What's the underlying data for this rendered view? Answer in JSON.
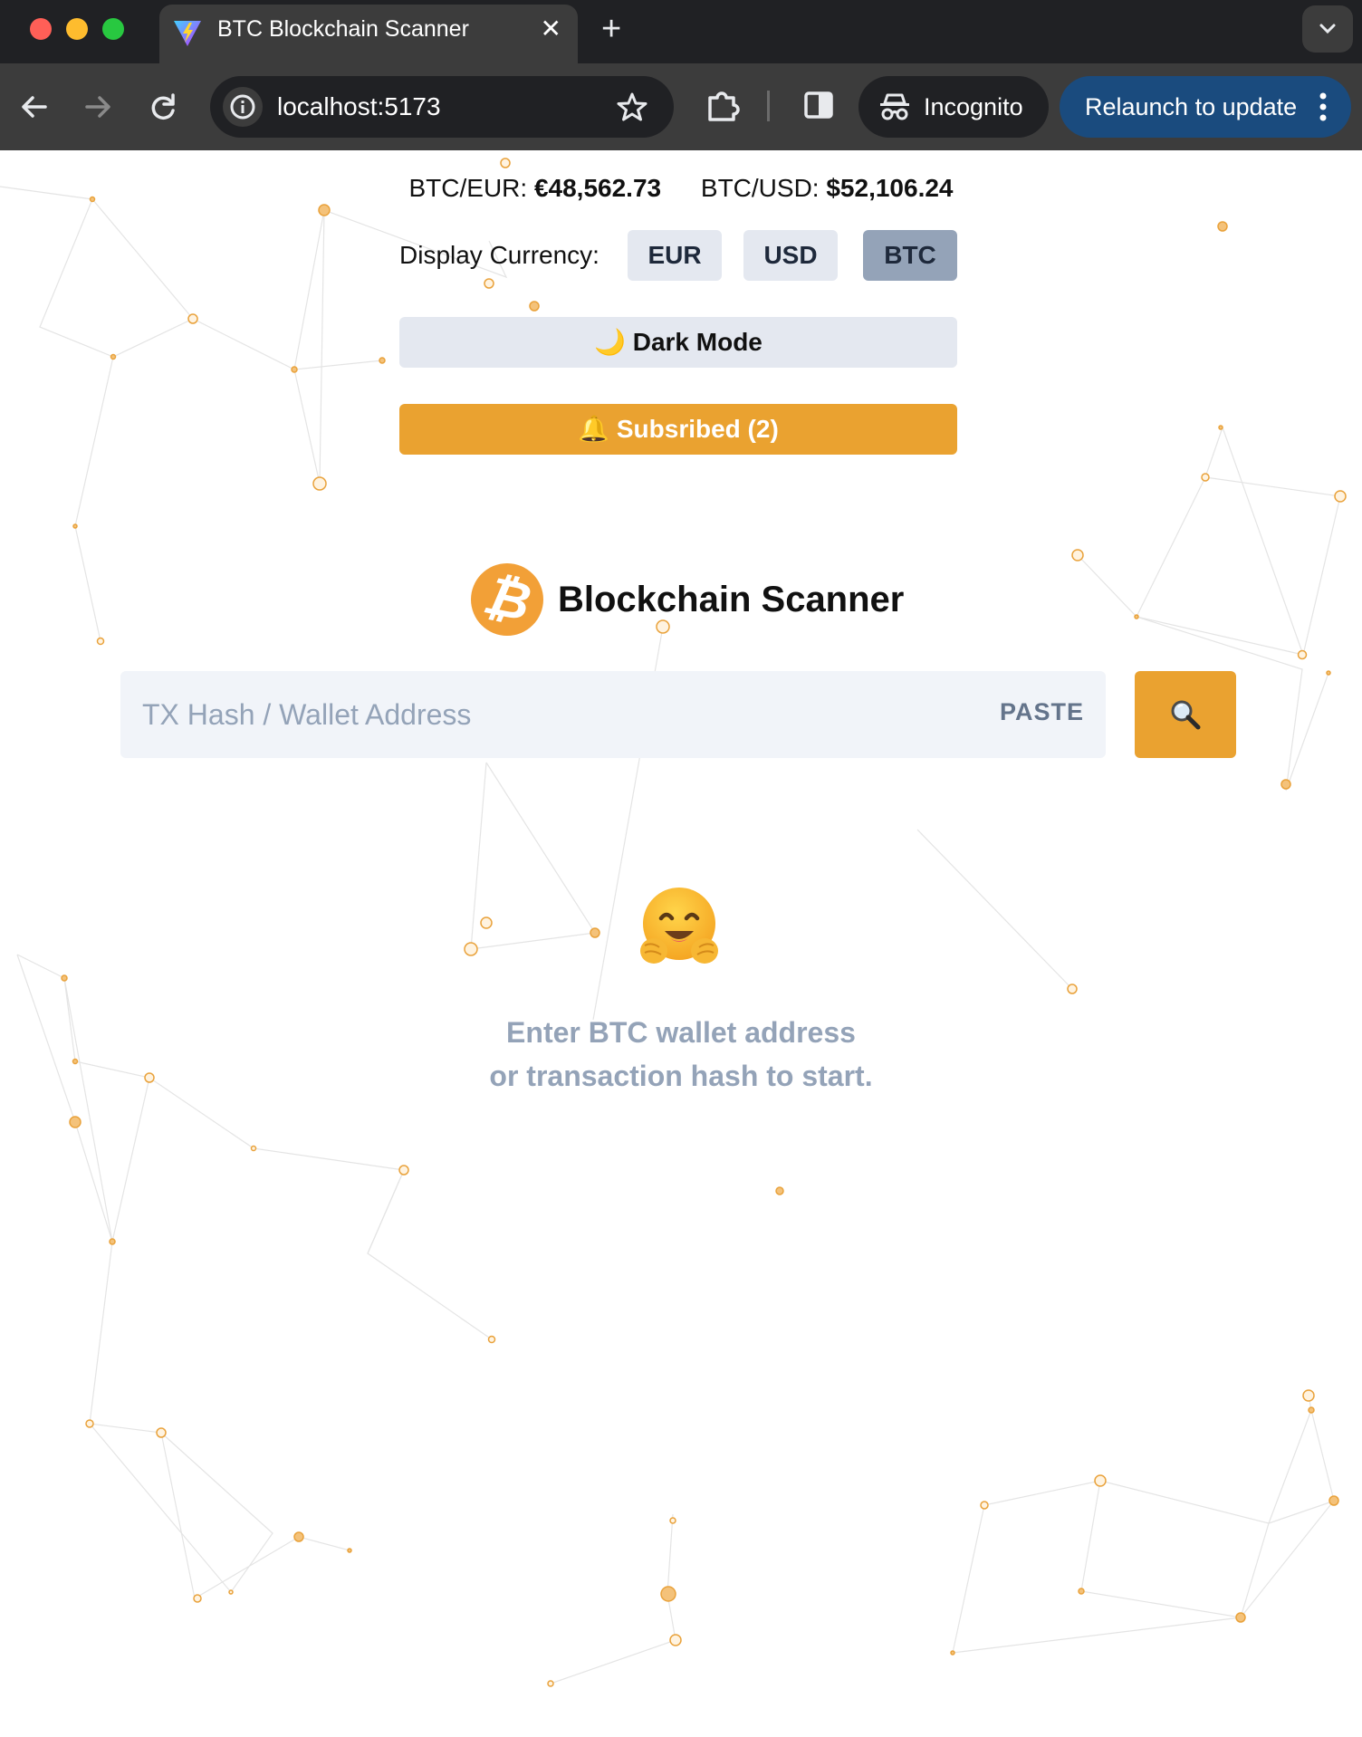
{
  "browser": {
    "tab_title": "BTC Blockchain Scanner",
    "tab_close": "✕",
    "new_tab": "+",
    "url": "localhost:5173",
    "incognito_label": "Incognito",
    "relaunch_label": "Relaunch to update"
  },
  "rates": {
    "eur_label": "BTC/EUR:",
    "eur_value": "€48,562.73",
    "usd_label": "BTC/USD:",
    "usd_value": "$52,106.24"
  },
  "currency": {
    "label": "Display Currency:",
    "options": [
      "EUR",
      "USD",
      "BTC"
    ],
    "selected": "BTC"
  },
  "dark_mode_label": "🌙 Dark Mode",
  "subscribed_label": "🔔 Subsribed (2)",
  "brand": {
    "logo_glyph": "₿",
    "title": "Blockchain Scanner",
    "logo_color": "#f2a037"
  },
  "search": {
    "placeholder": "TX Hash / Wallet Address",
    "value": "",
    "paste_label": "PASTE",
    "button_icon": "magnifier-icon"
  },
  "empty_state": {
    "icon": "hugging-face-emoji",
    "line1": "Enter BTC wallet address",
    "line2": "or transaction hash to start."
  },
  "colors": {
    "accent": "#eaa230",
    "muted_text": "#94a3b8",
    "button_bg": "#e4e8f0",
    "selected_button_bg": "#94a3b8"
  }
}
